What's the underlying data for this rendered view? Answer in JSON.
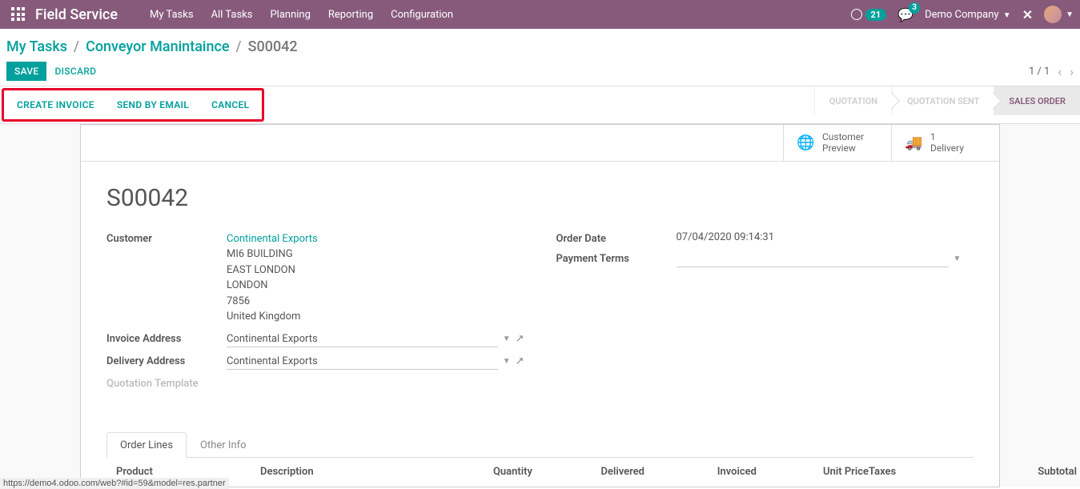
{
  "topnav": {
    "brand": "Field Service",
    "menu": [
      "My Tasks",
      "All Tasks",
      "Planning",
      "Reporting",
      "Configuration"
    ],
    "activity_count": "21",
    "chat_count": "3",
    "company": "Demo Company"
  },
  "breadcrumb": {
    "items": [
      "My Tasks",
      "Conveyor Manintaince"
    ],
    "current": "S00042"
  },
  "buttons": {
    "save": "SAVE",
    "discard": "DISCARD",
    "create_invoice": "CREATE INVOICE",
    "send_email": "SEND BY EMAIL",
    "cancel": "CANCEL"
  },
  "pager": {
    "text": "1 / 1"
  },
  "status": {
    "steps": [
      "QUOTATION",
      "QUOTATION SENT",
      "SALES ORDER"
    ]
  },
  "stat_buttons": {
    "preview": {
      "line1": "Customer",
      "line2": "Preview"
    },
    "delivery": {
      "line1": "1",
      "line2": "Delivery"
    }
  },
  "record": {
    "title": "S00042",
    "labels": {
      "customer": "Customer",
      "invoice_address": "Invoice Address",
      "delivery_address": "Delivery Address",
      "quotation_template": "Quotation Template",
      "order_date": "Order Date",
      "payment_terms": "Payment Terms"
    },
    "customer": {
      "name": "Continental Exports",
      "address": [
        "MI6 BUILDING",
        "EAST LONDON",
        "LONDON",
        "7856",
        "United Kingdom"
      ]
    },
    "invoice_address": "Continental Exports",
    "delivery_address": "Continental Exports",
    "order_date": "07/04/2020 09:14:31",
    "payment_terms": ""
  },
  "tabs": {
    "order_lines": "Order Lines",
    "other_info": "Other Info"
  },
  "table": {
    "cols": [
      "Product",
      "Description",
      "Quantity",
      "Delivered",
      "Invoiced",
      "Unit Price",
      "Taxes",
      "Subtotal"
    ]
  },
  "footer_url": "https://demo4.odoo.com/web?#id=59&model=res.partner"
}
